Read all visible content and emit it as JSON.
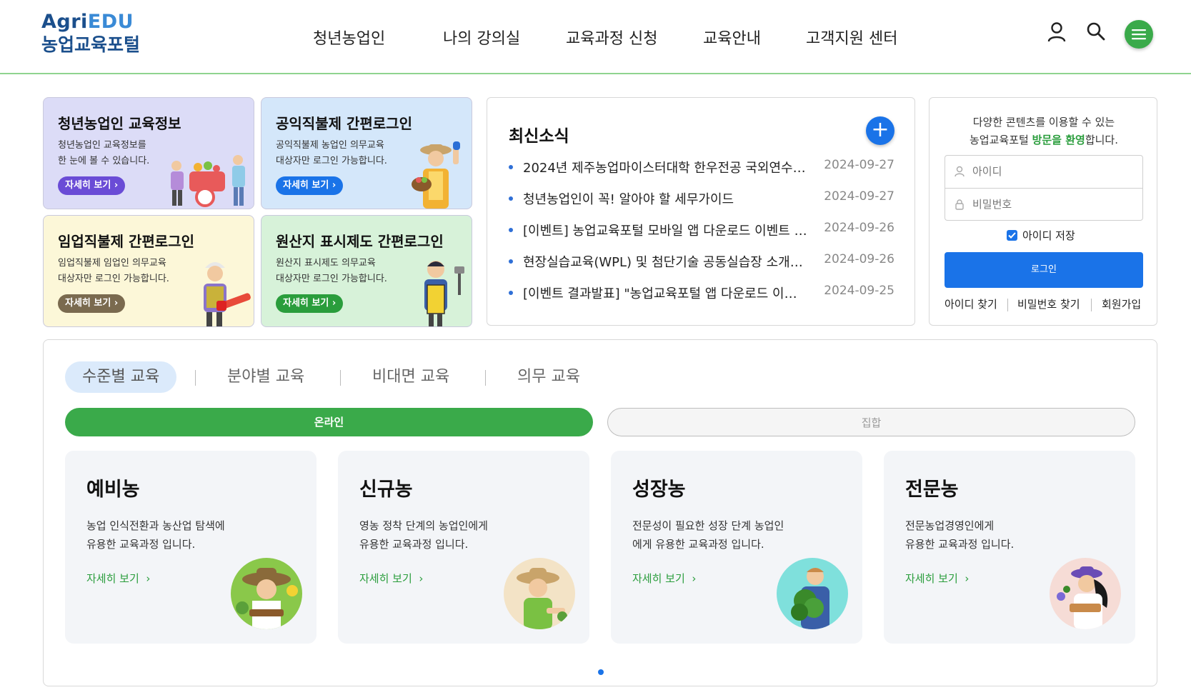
{
  "logo": {
    "en_prefix": "Agri",
    "en_suffix": "EDU",
    "ko": "농업교육포털"
  },
  "nav": [
    "청년농업인",
    "나의 강의실",
    "교육과정 신청",
    "교육안내",
    "고객지원 센터"
  ],
  "quick_cards": [
    {
      "title": "청년농업인 교육정보",
      "desc1": "청년농업인 교육정보를",
      "desc2": "한 눈에 볼 수 있습니다.",
      "button": "자세히 보기",
      "bg": "#dcdcf7",
      "btn_color": "#6a4cd6"
    },
    {
      "title": "공익직불제 간편로그인",
      "desc1": "공익직불제 농업인 의무교육",
      "desc2": "대상자만 로그인 가능합니다.",
      "button": "자세히 보기",
      "bg": "#d4e7fa",
      "btn_color": "#1a73e8"
    },
    {
      "title": "임업직불제 간편로그인",
      "desc1": "임업직불제 임업인 의무교육",
      "desc2": "대상자만 로그인 가능합니다.",
      "button": "자세히 보기",
      "bg": "#fcf7d8",
      "btn_color": "#7a6a4f"
    },
    {
      "title": "원산지 표시제도 간편로그인",
      "desc1": "원산지 표시제도 의무교육",
      "desc2": "대상자만 로그인 가능합니다.",
      "button": "자세히 보기",
      "bg": "#d7f2d9",
      "btn_color": "#2a9d3c"
    }
  ],
  "news": {
    "title": "최신소식",
    "plus": "+",
    "items": [
      {
        "text": "2024년 제주농업마이스터대학 한우전공 국외연수 …",
        "date": "2024-09-27"
      },
      {
        "text": "청년농업인이 꼭! 알아야 할 세무가이드",
        "date": "2024-09-27"
      },
      {
        "text": "[이벤트] 농업교육포털 모바일 앱 다운로드 이벤트 …",
        "date": "2024-09-26"
      },
      {
        "text": "현장실습교육(WPL) 및 첨단기술 공동실습장 소개자…",
        "date": "2024-09-26"
      },
      {
        "text": "[이벤트 결과발표] \"농업교육포털 앱 다운로드 이벤…",
        "date": "2024-09-25"
      }
    ]
  },
  "login": {
    "msg_line1": "다양한 콘텐츠를 이용할 수 있는",
    "msg_line2_a": "농업교육포털 ",
    "msg_line2_hl": "방문을 환영",
    "msg_line2_b": "합니다.",
    "id_placeholder": "아이디",
    "pw_placeholder": "비밀번호",
    "save_id": "아이디 저장",
    "login_button": "로그인",
    "find_id": "아이디 찾기",
    "find_pw": "비밀번호 찾기",
    "signup": "회원가입"
  },
  "course": {
    "tabs": [
      "수준별 교육",
      "분야별 교육",
      "비대면 교육",
      "의무 교육"
    ],
    "segments": [
      "온라인",
      "집합"
    ],
    "cards": [
      {
        "title": "예비농",
        "desc1": "농업 인식전환과 농산업 탐색에",
        "desc2": "유용한 교육과정 입니다.",
        "more": "자세히 보기"
      },
      {
        "title": "신규농",
        "desc1": "영농 정착 단계의 농업인에게",
        "desc2": "유용한 교육과정 입니다.",
        "more": "자세히 보기"
      },
      {
        "title": "성장농",
        "desc1": "전문성이 필요한 성장 단계 농업인",
        "desc2": "에게 유용한 교육과정 입니다.",
        "more": "자세히 보기"
      },
      {
        "title": "전문농",
        "desc1": "전문농업경영인에게",
        "desc2": "유용한 교육과정 입니다.",
        "more": "자세히 보기"
      }
    ]
  },
  "colors": {
    "brand_green": "#3aaa4a",
    "brand_blue": "#1a73e8",
    "navy": "#1b4f8c"
  }
}
